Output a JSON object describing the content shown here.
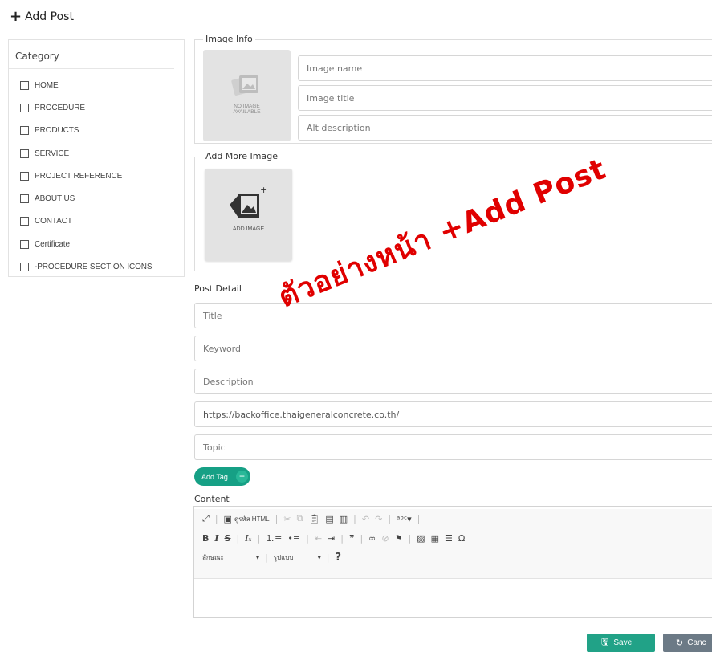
{
  "page": {
    "title": "Add Post",
    "plus": "+"
  },
  "category": {
    "heading": "Category",
    "items": [
      "HOME",
      "PROCEDURE",
      "PRODUCTS",
      "SERVICE",
      "PROJECT REFERENCE",
      "ABOUT US",
      "CONTACT",
      "Certificate",
      "-PROCEDURE SECTION ICONS"
    ]
  },
  "image_info": {
    "legend": "Image Info",
    "no_image_line1": "NO IMAGE",
    "no_image_line2": "AVAILABLE",
    "name_placeholder": "Image name",
    "title_placeholder": "Image title",
    "alt_placeholder": "Alt description"
  },
  "add_more_image": {
    "legend": "Add More Image",
    "label": "ADD IMAGE"
  },
  "post_detail": {
    "heading": "Post Detail",
    "title_placeholder": "Title",
    "keyword_placeholder": "Keyword",
    "description_placeholder": "Description",
    "url_value": "https://backoffice.thaigeneralconcrete.co.th/",
    "topic_placeholder": "Topic",
    "add_tag": "Add Tag",
    "add_tag_plus": "+"
  },
  "content": {
    "heading": "Content",
    "source_button": "ดูรหัส HTML",
    "format_combo": "ลักษณะ",
    "style_combo": "รูปแบบ",
    "help": "?"
  },
  "watermark": "ตัวอย่างหน้า +Add Post",
  "actions": {
    "save": "Save",
    "cancel": "Canc"
  },
  "colors": {
    "accent": "#16a085",
    "save": "#21a287",
    "cancel": "#6c7a86",
    "watermark": "#e00000"
  }
}
